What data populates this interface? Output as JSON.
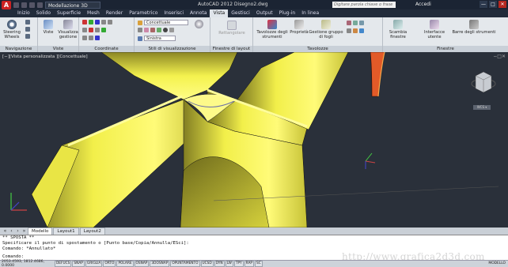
{
  "window": {
    "workspace": "Modellazione 3D",
    "title": "AutoCAD 2012   Disegno2.dwg",
    "search_placeholder": "Digitare parola chiave o frase",
    "login": "Accedi",
    "controls": [
      "—",
      "□",
      "✕"
    ]
  },
  "menu_tabs": [
    "Inizio",
    "Solido",
    "Superficie",
    "Mesh",
    "Render",
    "Parametrico",
    "Inserisci",
    "Annota",
    "Vista",
    "Gestisci",
    "Output",
    "Plug-in",
    "In linea"
  ],
  "active_tab": "Vista",
  "ribbon": {
    "navigazione": {
      "title": "Navigazione",
      "steering": "Steering Wheels"
    },
    "viste": {
      "title": "Viste",
      "viste": "Viste",
      "visualizza": "Visualizza gestione"
    },
    "coordinate": {
      "title": "Coordinate"
    },
    "stili": {
      "title": "Stili di visualizzazione",
      "style": "Concettuale",
      "view": "Sinistra"
    },
    "finestre_layout": {
      "title": "Finestre di layout",
      "rettangolare": "Rettangolare"
    },
    "tavolozze": {
      "title": "Tavolozze",
      "strumenti": "Tavolozze degli strumenti",
      "proprieta": "Proprietà",
      "gestione": "Gestione gruppo di fogli"
    },
    "finestre": {
      "title": "Finestre",
      "scambia": "Scambia finestre",
      "interfaccia": "Interfacce utente",
      "barre": "Barre degli strumenti"
    }
  },
  "viewport": {
    "label": "[−][Vista personalizzata ][Concettuale]",
    "close": "−□✕",
    "wcs": "WCS ▾"
  },
  "layout_tabs": [
    "Modello",
    "Layout1",
    "Layout2"
  ],
  "active_layout": "Modello",
  "command": {
    "line1": "** SPOSTA **",
    "line2": "Specificare il punto di spostamento o [Punto base/Copia/Annulla/ESci]:",
    "line3": "Comando: *Annullato*",
    "prompt": "Comando:"
  },
  "watermark": "http://www.grafica2d3d.com",
  "status": {
    "coordinates": "2053.4593, 1812.4686, 0.0000",
    "toggles": [
      "DEFUCS",
      "SNAP",
      "GRIGLIA",
      "ORTO",
      "POLARE",
      "OSNAP",
      "3DOSNAP",
      "OPUNTAMENTO",
      "UCSD",
      "DYN",
      "LW",
      "TPY",
      "RAP",
      "SC"
    ],
    "right_label": "MODELLO"
  },
  "colors": {
    "accent": "#f5f050",
    "viewport_bg": "#2a303a",
    "titlebar": "#1b2433"
  }
}
